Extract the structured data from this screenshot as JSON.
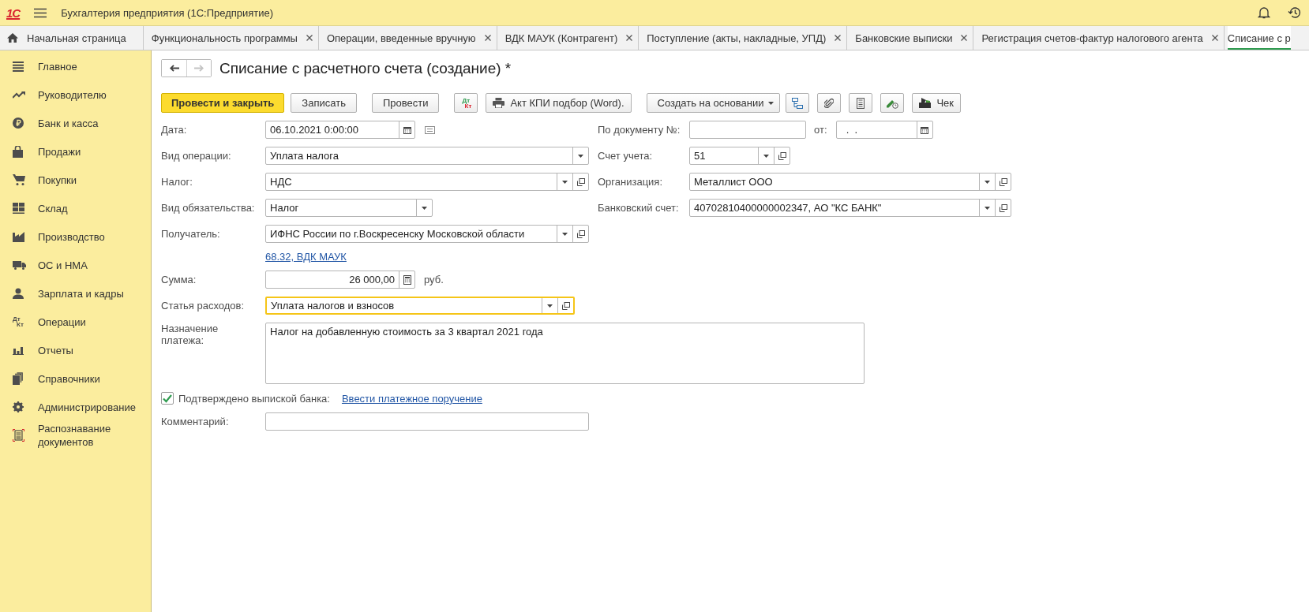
{
  "app": {
    "logo": "1С",
    "title": "Бухгалтерия предприятия  (1С:Предприятие)"
  },
  "tabs": [
    {
      "label": "Начальная страница",
      "kind": "home",
      "closable": false,
      "selected": false
    },
    {
      "label": "Функциональность программы",
      "kind": "document",
      "closable": true,
      "selected": false
    },
    {
      "label": "Операции, введенные вручную",
      "kind": "document",
      "closable": true,
      "selected": false
    },
    {
      "label": "ВДК МАУК (Контрагент)",
      "kind": "document",
      "closable": true,
      "selected": false
    },
    {
      "label": "Поступление (акты, накладные, УПД)",
      "kind": "document",
      "closable": true,
      "selected": false
    },
    {
      "label": "Банковские выписки",
      "kind": "document",
      "closable": true,
      "selected": false
    },
    {
      "label": "Регистрация счетов-фактур налогового агента",
      "kind": "document",
      "closable": true,
      "selected": false
    },
    {
      "label": "Списание с р",
      "kind": "document",
      "closable": false,
      "selected": true
    }
  ],
  "sidebar": {
    "items": [
      {
        "label": "Главное"
      },
      {
        "label": "Руководителю"
      },
      {
        "label": "Банк и касса"
      },
      {
        "label": "Продажи"
      },
      {
        "label": "Покупки"
      },
      {
        "label": "Склад"
      },
      {
        "label": "Производство"
      },
      {
        "label": "ОС и НМА"
      },
      {
        "label": "Зарплата и кадры"
      },
      {
        "label": "Операции",
        "icon_labels": [
          "Дт",
          "Кт"
        ]
      },
      {
        "label": "Отчеты"
      },
      {
        "label": "Справочники"
      },
      {
        "label": "Администрирование"
      },
      {
        "label": "Распознавание документов"
      }
    ]
  },
  "form": {
    "title": "Списание с расчетного счета (создание) *",
    "back": {
      "disabled": false
    },
    "forward": {
      "disabled": true
    },
    "toolbar": [
      {
        "kind": "primary",
        "label": "Провести и закрыть"
      },
      {
        "kind": "plain",
        "label": "Записать"
      },
      {
        "kind": "plain",
        "label": "Провести"
      },
      {
        "kind": "dtkt",
        "labels": [
          "Дт",
          "Кт"
        ]
      },
      {
        "kind": "print",
        "label": "Акт КПИ подбор (Word)."
      },
      {
        "kind": "dropdown",
        "label": "Создать на основании"
      },
      {
        "kind": "icon"
      },
      {
        "kind": "icon"
      },
      {
        "kind": "icon"
      },
      {
        "kind": "icon"
      },
      {
        "kind": "check",
        "label": "Чек"
      }
    ],
    "date": {
      "label": "Дата:",
      "value": "06.10.2021  0:00:00"
    },
    "doc_number": {
      "label": "По документу №:"
    },
    "doc_date": {
      "label": "от:",
      "value": "  .  ."
    },
    "operation": {
      "label": "Вид операции:",
      "value": "Уплата налога",
      "open_button": false
    },
    "account": {
      "label": "Счет учета:",
      "value": "51",
      "open_button": true
    },
    "tax": {
      "label": "Налог:",
      "value": "НДС",
      "open_button": true
    },
    "organization": {
      "label": "Организация:",
      "value": "Металлист ООО",
      "open_button": true
    },
    "obligation": {
      "label": "Вид обязательства:",
      "value": "Налог",
      "open_button": false
    },
    "bank_account": {
      "label": "Банковский счет:",
      "value": "40702810400000002347, АО \"КС БАНК\"",
      "open_button": true
    },
    "recipient": {
      "label": "Получатель:",
      "value": "ИФНС России по г.Воскресенску Московской области",
      "open_button": true
    },
    "settlement_link": "68.32, ВДК МАУК",
    "amount": {
      "label": "Сумма:",
      "value": "26 000,00",
      "currency": "руб."
    },
    "expense_item": {
      "label": "Статья расходов:",
      "value": "Уплата налогов и взносов",
      "open_button": true,
      "focused": true
    },
    "purpose": {
      "label": "Назначение платежа:",
      "value": "Налог на добавленную стоимость за 3 квартал 2021 года"
    },
    "confirmed": {
      "label": "Подтверждено выпиской банка:",
      "checked": true,
      "link": "Ввести платежное поручение"
    },
    "comment": {
      "label": "Комментарий:"
    }
  }
}
